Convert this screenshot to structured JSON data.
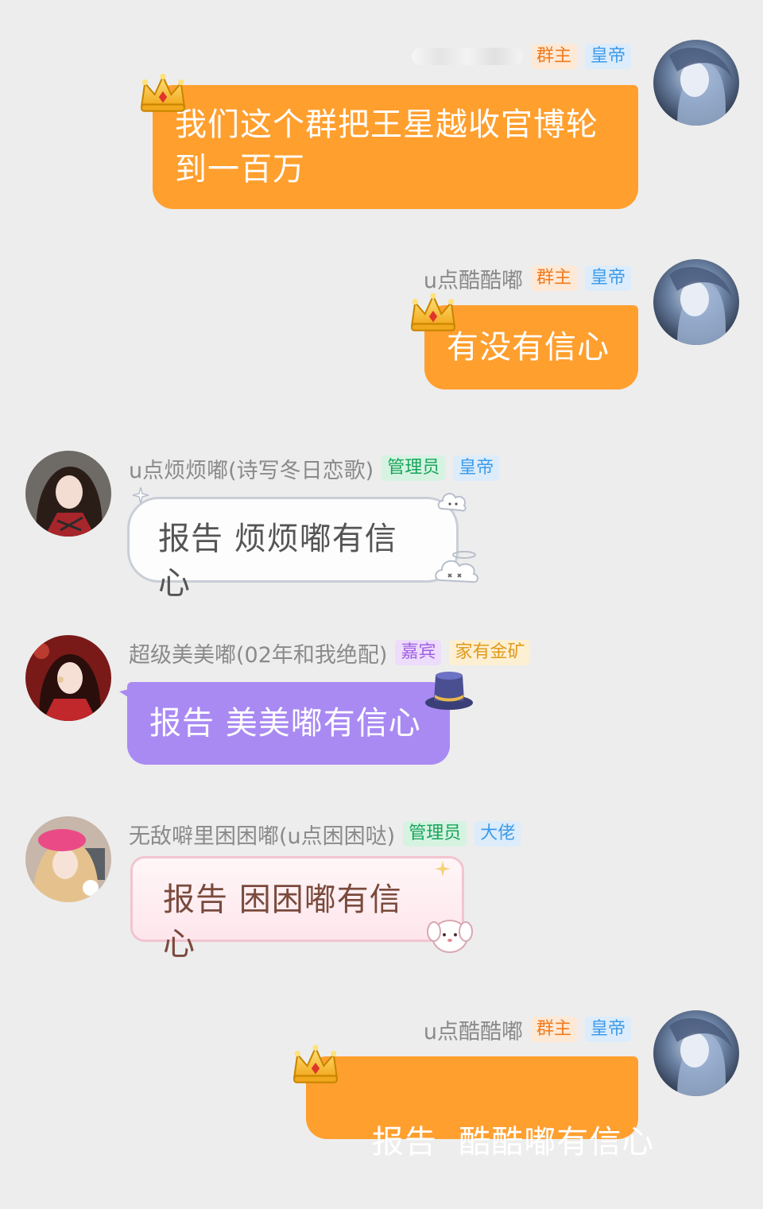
{
  "messages": [
    {
      "id": "m1",
      "side": "right",
      "sender": "",
      "badges": [
        "群主",
        "皇帝"
      ],
      "text_lines": [
        "我们这个群把王星越收官博轮",
        "到一百万"
      ]
    },
    {
      "id": "m2",
      "side": "right",
      "sender": "u点酷酷嘟",
      "badges": [
        "群主",
        "皇帝"
      ],
      "text": "有没有信心"
    },
    {
      "id": "m3",
      "side": "left",
      "sender": "u点烦烦嘟(诗写冬日恋歌)",
      "badges": [
        "管理员",
        "皇帝"
      ],
      "text": "报告 烦烦嘟有信心"
    },
    {
      "id": "m4",
      "side": "left",
      "sender": "超级美美嘟(02年和我绝配)",
      "badges": [
        "嘉宾",
        "家有金矿"
      ],
      "text": "报告 美美嘟有信心"
    },
    {
      "id": "m5",
      "side": "left",
      "sender": "无敌噼里困困嘟(u点困困哒)",
      "badges": [
        "管理员",
        "大佬"
      ],
      "text": "报告 困困嘟有信心"
    },
    {
      "id": "m6",
      "side": "right",
      "sender": "u点酷酷嘟",
      "badges": [
        "群主",
        "皇帝"
      ],
      "text": "报告  酷酷嘟有信心"
    }
  ],
  "icons": {
    "crown": "crown-icon",
    "hat": "top-hat-icon",
    "cloud": "cloud-sticker-icon",
    "puppy": "puppy-sticker-icon"
  },
  "colors": {
    "background": "#ededed",
    "orange_bubble": "#ff9f2e",
    "purple_bubble": "#a98af3",
    "owner_badge": "#f27a1c",
    "emperor_badge": "#3d9be9",
    "admin_badge": "#17a45a",
    "guest_badge": "#a161e3"
  }
}
